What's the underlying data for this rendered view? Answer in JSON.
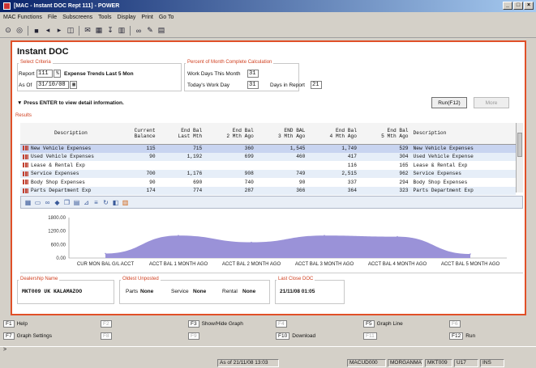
{
  "window": {
    "title": "[MAC - Instant DOC Rept 111] - POWER",
    "buttons": [
      "_",
      "□",
      "×"
    ]
  },
  "menu": [
    "MAC Functions",
    "File",
    "Subscreens",
    "Tools",
    "Display",
    "Print",
    "Go To"
  ],
  "page": {
    "title": "Instant DOC"
  },
  "criteria": {
    "title": "Select Criteria",
    "report_label": "Report",
    "report_value": "111",
    "report_btn": "%",
    "report_desc": "Expense Trends Last 5 Mon",
    "asof_label": "As Of",
    "asof_value": "31/10/08"
  },
  "percent": {
    "title": "Percent of Month Complete Calculation",
    "work_days_label": "Work Days This Month",
    "work_days_value": "31",
    "todays_label": "Today's Work Day",
    "todays_value": "31",
    "days_report_label": "Days in Report",
    "days_report_value": "21"
  },
  "hint": "Press ENTER to view detail information.",
  "buttons": {
    "run": "Run(F12)",
    "more": "More"
  },
  "results": {
    "title": "Results",
    "columns": [
      "Description",
      "Current\nBalance",
      "End Bal\nLast Mth",
      "End Bal\n2 Mth Ago",
      "END BAL\n3 Mth Ago",
      "End Bal\n4 Mth Ago",
      "End Bal\n5 Mth Ago",
      "Description"
    ],
    "rows": [
      [
        "New Vehicle Expenses",
        "115",
        "715",
        "360",
        "1,545",
        "1,749",
        "529",
        "New Vehicle Expenses"
      ],
      [
        "Used Vehicle Expenses",
        "90",
        "1,192",
        "699",
        "460",
        "417",
        "304",
        "Used Vehicle Expense"
      ],
      [
        "Lease & Rental Exp",
        "",
        "",
        "",
        "",
        "116",
        "165",
        "Lease & Rental Exp"
      ],
      [
        "Service Expenses",
        "700",
        "1,176",
        "908",
        "749",
        "2,515",
        "962",
        "Service Expenses"
      ],
      [
        "Body Shop Expenses",
        "90",
        "690",
        "740",
        "90",
        "337",
        "294",
        "Body Shop Expenses"
      ],
      [
        "Parts Department Exp",
        "174",
        "774",
        "287",
        "366",
        "364",
        "323",
        "Parts Department Exp"
      ]
    ]
  },
  "chart_data": {
    "type": "area",
    "categories": [
      "CUR MON BAL G/L ACCT",
      "ACCT BAL 1 MONTH AGO",
      "ACCT BAL 2 MONTH AGO",
      "ACCT BAL 3 MONTH AGO",
      "ACCT BAL 4 MONTH AGO",
      "ACCT BAL 5 MONTH AGO"
    ],
    "values": [
      200,
      1000,
      700,
      1000,
      950,
      180
    ],
    "yticks": [
      "1800.00",
      "1200.00",
      "600.00",
      "0.00"
    ],
    "ylim": [
      0,
      1800
    ],
    "color": "#9a92d8"
  },
  "dealership": {
    "label": "Dealership Name",
    "value": "MKT009 UK KALAMAZOO"
  },
  "oldest": {
    "label": "Oldest Unposted",
    "parts_label": "Parts",
    "parts_value": "None",
    "service_label": "Service",
    "service_value": "None",
    "rental_label": "Rental",
    "rental_value": "None"
  },
  "lastclose": {
    "label": "Last Close DOC",
    "value": "21/11/08 01:05"
  },
  "fkeys": [
    {
      "key": "F1",
      "label": "Help",
      "enabled": true
    },
    {
      "key": "F2",
      "label": "",
      "enabled": false
    },
    {
      "key": "F3",
      "label": "Show/Hide Graph",
      "enabled": true
    },
    {
      "key": "F4",
      "label": "",
      "enabled": false
    },
    {
      "key": "F5",
      "label": "Graph Line",
      "enabled": true
    },
    {
      "key": "F6",
      "label": "",
      "enabled": false
    },
    {
      "key": "F7",
      "label": "Graph Settings",
      "enabled": true
    },
    {
      "key": "F8",
      "label": "",
      "enabled": false
    },
    {
      "key": "F9",
      "label": "",
      "enabled": false
    },
    {
      "key": "F10",
      "label": "Download",
      "enabled": true
    },
    {
      "key": "F11",
      "label": "",
      "enabled": false
    },
    {
      "key": "F12",
      "label": "Run",
      "enabled": true
    }
  ],
  "cmdline": ">",
  "status": [
    "As of 21/11/08 13:03",
    "MACUD000",
    "MORGANMA",
    "MKT009",
    "U17",
    "INS"
  ]
}
